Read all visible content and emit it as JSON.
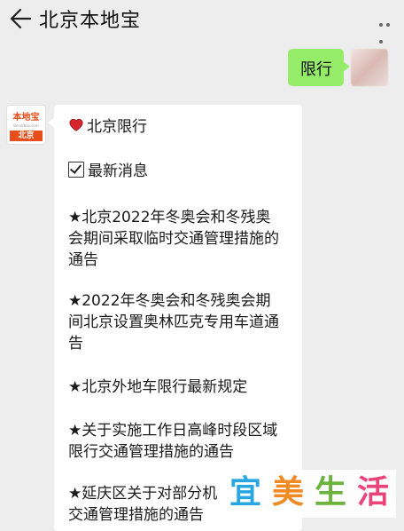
{
  "header": {
    "title": "北京本地宝"
  },
  "chat": {
    "my_message": "限行",
    "brand_avatar": {
      "top": "本地宝",
      "sub": "Bendibao.com",
      "city": "北京"
    },
    "card": {
      "heading": "北京限行",
      "subheading": "最新消息",
      "items": [
        [
          "★北京2022年冬奥会和冬残奥",
          "会期间采取临时交通管理措施的",
          "通告"
        ],
        [
          "★2022年冬奥会和冬残奥会期",
          "间北京设置奥林匹克专用车道通",
          "告"
        ],
        [
          "★北京外地车限行最新规定"
        ],
        [
          "★关于实施工作日高峰时段区域",
          "限行交通管理措施的通告"
        ],
        [
          "★延庆区关于对部分机",
          "交通管理措施的通告"
        ]
      ]
    }
  },
  "watermark": {
    "chars": [
      "宜",
      "美",
      "生",
      "活"
    ]
  }
}
